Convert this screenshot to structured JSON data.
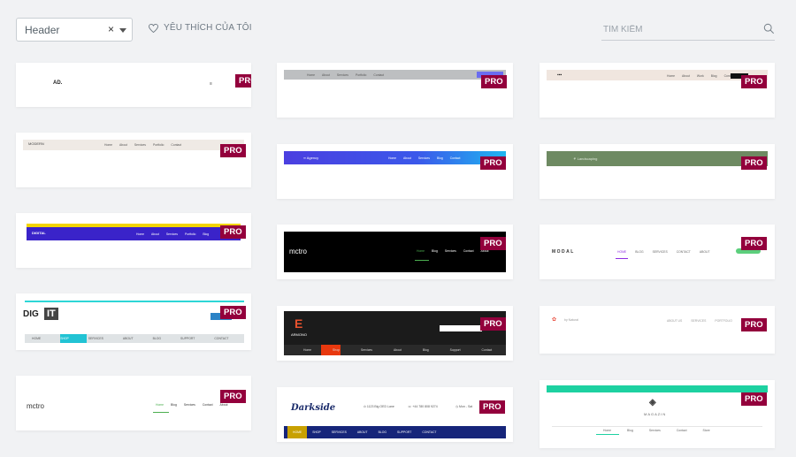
{
  "filter": {
    "value": "Header",
    "clear": "×"
  },
  "favorites": {
    "label": "YÊU THÍCH CỦA TÔI"
  },
  "search": {
    "placeholder": "TÌM KIẾM"
  },
  "badge": "PRO",
  "templates": [
    {
      "logo": "AD.",
      "nav": []
    },
    {
      "logo": "",
      "nav": [
        "Home",
        "About",
        "Services",
        "Portfolio",
        "Contact"
      ]
    },
    {
      "logo": "",
      "nav": [
        "Home",
        "About",
        "Work",
        "Blog",
        "Contact"
      ]
    },
    {
      "logo": "",
      "nav": [
        "Home",
        "About",
        "Services",
        "Portfolio",
        "Contact"
      ]
    },
    {
      "logo": "",
      "nav": [
        "Home",
        "About",
        "Services",
        "Blog",
        "Contact"
      ]
    },
    {
      "logo": "",
      "nav": []
    },
    {
      "logo": "",
      "nav": [
        "Home",
        "About",
        "Services",
        "Portfolio",
        "Blog"
      ]
    },
    {
      "logo": "mctro",
      "nav": [
        "Home",
        "Blog",
        "Services",
        "Contact",
        "About"
      ]
    },
    {
      "logo": "MODAL",
      "nav": [
        "HOME",
        "BLOG",
        "SERVICES",
        "CONTACT",
        "ABOUT"
      ]
    },
    {
      "logo": "DIG IT",
      "nav": [
        "HOME",
        "SHOP",
        "SERVICES",
        "ABOUT",
        "BLOG",
        "SUPPORT",
        "CONTACT"
      ]
    },
    {
      "logo": "ARMONO",
      "nav": [
        "Home",
        "Shop",
        "Services",
        "About",
        "Blog",
        "Support",
        "Contact"
      ]
    },
    {
      "logo": "",
      "nav": [
        "ABOUT US",
        "SERVICES",
        "PORTFOLIO",
        "SHOP"
      ]
    },
    {
      "logo": "mctro",
      "nav": [
        "Home",
        "Blog",
        "Services",
        "Contact",
        "About"
      ]
    },
    {
      "logo": "Darkside",
      "nav": [
        "HOME",
        "SHOP",
        "SERVICES",
        "ABOUT",
        "BLOG",
        "SUPPORT",
        "CONTACT"
      ]
    },
    {
      "logo": "MAGAZIN",
      "nav": [
        "Home",
        "Blog",
        "Services",
        "Contact",
        "Store"
      ]
    }
  ],
  "colors": {
    "pro": "#93003c",
    "bg": "#f1f2f4"
  }
}
